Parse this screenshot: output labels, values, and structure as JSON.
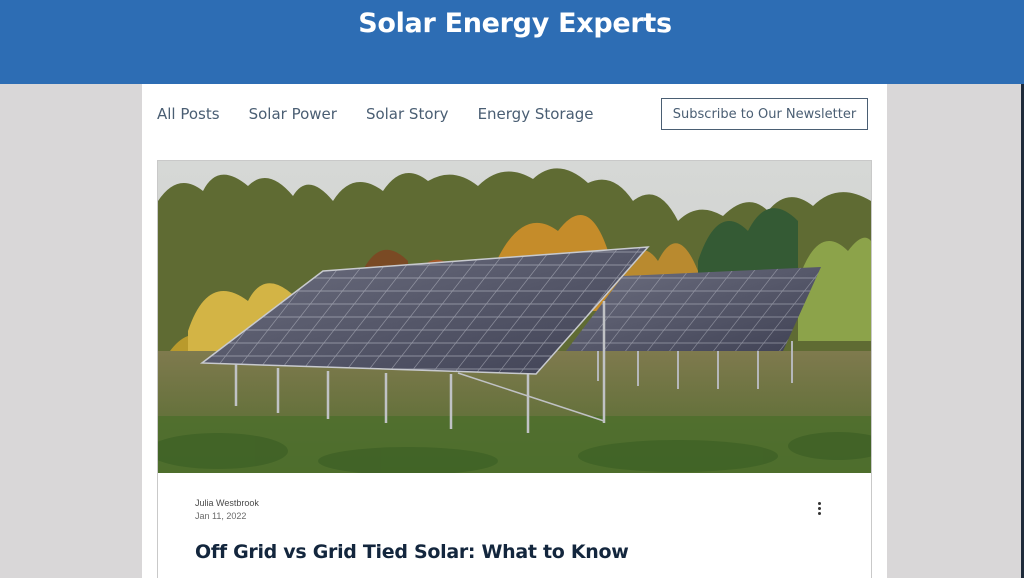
{
  "header": {
    "title": "Solar Energy Experts"
  },
  "nav": {
    "items": [
      {
        "label": "All Posts"
      },
      {
        "label": "Solar Power"
      },
      {
        "label": "Solar Story"
      },
      {
        "label": "Energy Storage"
      }
    ],
    "subscribe_label": "Subscribe to Our Newsletter"
  },
  "post": {
    "image_icon": "solar-panel-field-photo",
    "author": "Julia Westbrook",
    "date": "Jan 11, 2022",
    "title": "Off Grid vs Grid Tied Solar: What to Know",
    "menu_icon": "more-vertical-icon"
  },
  "colors": {
    "header_bg": "#2d6db4",
    "page_bg": "#d9d7d8",
    "nav_text": "#4a5e73",
    "title_text": "#13263d"
  }
}
